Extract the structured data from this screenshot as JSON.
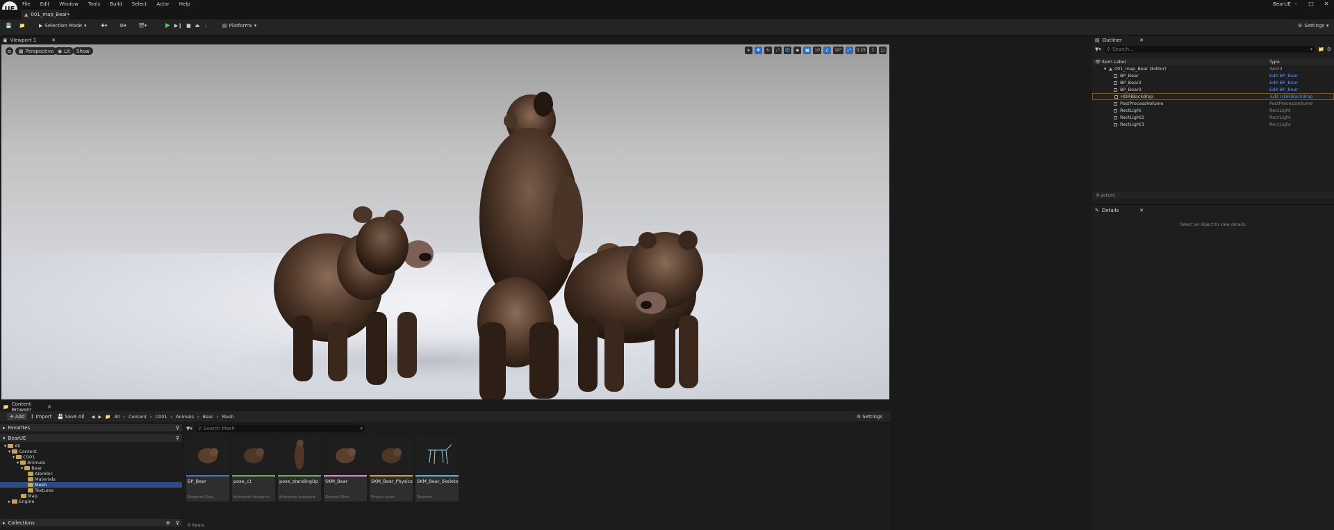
{
  "menubar": {
    "items": [
      "File",
      "Edit",
      "Window",
      "Tools",
      "Build",
      "Select",
      "Actor",
      "Help"
    ],
    "project_name": "BearUE",
    "logo_text": "UE"
  },
  "document_tab": {
    "label": "001_map_Bear•"
  },
  "toolbar": {
    "selection_mode": "Selection Mode",
    "platforms": "Platforms",
    "settings": "Settings"
  },
  "viewport": {
    "tab_label": "Viewport 1",
    "perspective": "Perspective",
    "lit": "Lit",
    "show": "Show",
    "grid_snap": "10",
    "rotation_snap": "10°",
    "scale_snap": "0.25",
    "camera_speed": "1"
  },
  "content_browser": {
    "tab_label": "Content Browser",
    "add": "Add",
    "import": "Import",
    "save_all": "Save All",
    "settings": "Settings",
    "breadcrumb": [
      "All",
      "Content",
      "C001",
      "Animals",
      "Bear",
      "Mesh"
    ],
    "favorites": "Favorites",
    "project_root": "BearUE",
    "collections": "Collections",
    "search_placeholder": "Search Mesh",
    "item_count": "6 items",
    "tree": [
      {
        "label": "All",
        "depth": 0
      },
      {
        "label": "Content",
        "depth": 1
      },
      {
        "label": "C001",
        "depth": 2
      },
      {
        "label": "Animals",
        "depth": 3
      },
      {
        "label": "Bear",
        "depth": 4
      },
      {
        "label": "Alembic",
        "depth": 5
      },
      {
        "label": "Materials",
        "depth": 5
      },
      {
        "label": "Mesh",
        "depth": 5,
        "selected": true
      },
      {
        "label": "Textures",
        "depth": 5
      },
      {
        "label": "Map",
        "depth": 3
      },
      {
        "label": "Engine",
        "depth": 1
      }
    ],
    "assets": [
      {
        "name": "BP_Bear",
        "type": "Blueprint Class",
        "color": "#3b7bd4"
      },
      {
        "name": "pose_c1",
        "type": "Animation Sequence",
        "color": "#6fb050"
      },
      {
        "name": "pose_standingUp",
        "type": "Animation Sequence",
        "color": "#6fb050"
      },
      {
        "name": "SKM_Bear",
        "type": "Skeletal Mesh",
        "color": "#e08ad0"
      },
      {
        "name": "SKM_Bear_PhysicsAsset",
        "type": "Physics Asset",
        "color": "#e0a040"
      },
      {
        "name": "SKM_Bear_Skeleton",
        "type": "Skeleton",
        "color": "#5fb0e0"
      }
    ]
  },
  "outliner": {
    "tab_label": "Outliner",
    "search_placeholder": "Search...",
    "col_label": "Item Label",
    "col_type": "Type",
    "root": {
      "label": "001_map_Bear (Editor)",
      "type": "World"
    },
    "rows": [
      {
        "label": "BP_Bear",
        "type": "Edit BP_Bear",
        "link": true
      },
      {
        "label": "BP_Bear2",
        "type": "Edit BP_Bear",
        "link": true
      },
      {
        "label": "BP_Bear3",
        "type": "Edit BP_Bear",
        "link": true
      },
      {
        "label": "HDRIBackdrop",
        "type": "Edit HDRIBackdrop",
        "link": true,
        "highlight": true
      },
      {
        "label": "PostProcessVolume",
        "type": "PostProcessVolume",
        "link": false
      },
      {
        "label": "RectLight",
        "type": "RectLight",
        "link": false
      },
      {
        "label": "RectLight2",
        "type": "RectLight",
        "link": false
      },
      {
        "label": "RectLight3",
        "type": "RectLight",
        "link": false
      }
    ],
    "count": "8 actors"
  },
  "details": {
    "tab_label": "Details",
    "empty_text": "Select an object to view details."
  }
}
